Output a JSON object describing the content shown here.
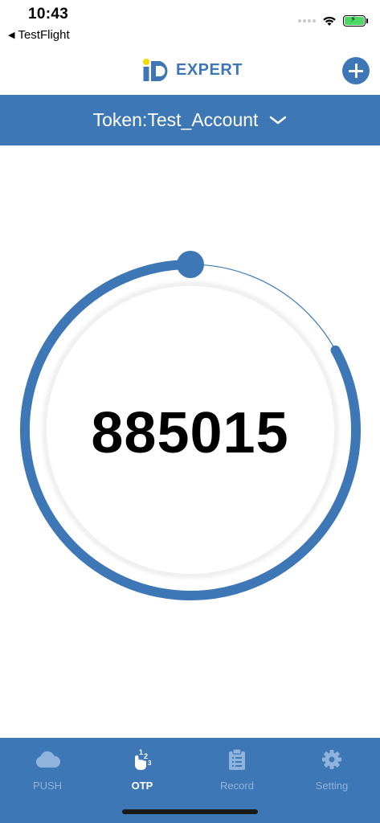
{
  "status_bar": {
    "time": "10:43",
    "back_app": "TestFlight"
  },
  "header": {
    "logo_text": "EXPERT"
  },
  "token": {
    "label": "Token:Test_Account"
  },
  "otp": {
    "code": "885015",
    "remaining_fraction": 0.83
  },
  "tabs": [
    {
      "label": "PUSH",
      "icon": "cloud-icon",
      "active": false
    },
    {
      "label": "OTP",
      "icon": "otp-touch-icon",
      "active": true
    },
    {
      "label": "Record",
      "icon": "clipboard-icon",
      "active": false
    },
    {
      "label": "Setting",
      "icon": "gear-icon",
      "active": false
    }
  ],
  "colors": {
    "brand_blue": "#3d77b6",
    "inactive_tab": "#8fb3dc",
    "logo_dot": "#f5d800"
  }
}
